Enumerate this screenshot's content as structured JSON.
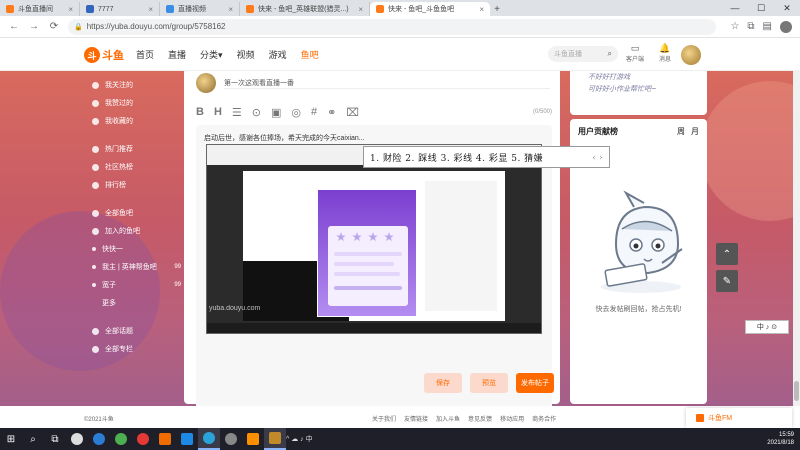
{
  "browser": {
    "tabs": [
      {
        "title": "斗鱼直播间"
      },
      {
        "title": "7777"
      },
      {
        "title": "直播视频"
      },
      {
        "title": "快来 - 鱼吧_英雄联盟(猎灵...)"
      },
      {
        "title": "快来 - 鱼吧_斗鱼鱼吧"
      }
    ],
    "url": "https://yuba.douyu.com/group/5758162",
    "new_tab": "+",
    "min": "—",
    "max": "☐",
    "close": "✕",
    "back": "←",
    "forward": "→",
    "reload": "⟳"
  },
  "header": {
    "logo_mark": "斗",
    "logo_text": "斗鱼",
    "nav": [
      "首页",
      "直播",
      "分类",
      "视频",
      "游戏",
      "鱼吧"
    ],
    "search_placeholder": "斗鱼直播",
    "icons": [
      {
        "name": "客户端",
        "glyph": "▭"
      },
      {
        "name": "消息",
        "glyph": "🔔"
      }
    ]
  },
  "sidebar": {
    "group1": [
      "我关注的",
      "我赞过的",
      "我收藏的"
    ],
    "group2": [
      "热门推荐",
      "社区热榜",
      "排行榜"
    ],
    "group3": [
      "全部鱼吧",
      "加入的鱼吧"
    ],
    "joined": [
      {
        "label": "快快一",
        "num": ""
      },
      {
        "label": "我主 | 英神帮鱼吧",
        "num": "99"
      },
      {
        "label": "宽子",
        "num": "99"
      },
      {
        "label": "更多",
        "num": ""
      }
    ],
    "group4": [
      "全部话题",
      "全部专栏"
    ]
  },
  "post": {
    "title_placeholder": "第一次这观看直播一番",
    "word_count": "(0/500)",
    "body_text": "启动后世，感谢各位捧场，希天完成的今天caixian...",
    "shot_watermark": "yuba.douyu.com",
    "overlay": "1. 财险  2. 踩线  3. 彩线  4. 彩显  5. 猜嫌",
    "overlay_arrow": "‹ ›",
    "buttons": {
      "save": "保存",
      "preview": "预览",
      "publish": "发布帖子"
    }
  },
  "right_panel": {
    "hand_text_1": "不好好打游戏",
    "hand_text_2": "可好好小作业帮忙吧~",
    "ranking_title": "用户贡献榜",
    "tab_week": "周",
    "tab_month": "月",
    "empty_text": "快去发帖刷回帖，抢占先机!"
  },
  "footer": {
    "copyright": "©2021斗鱼",
    "links": [
      "关于我们",
      "友情链接",
      "加入斗鱼",
      "意见反馈",
      "移动应用",
      "商务合作"
    ]
  },
  "toast": {
    "text": "斗鱼FM"
  },
  "ime": {
    "text": "中 ♪ ⊙"
  },
  "taskbar": {
    "time": "15:59",
    "date": "2021/8/18",
    "tray": "^ ☁ ♪ 中"
  },
  "colors": {
    "brand": "#ff6a00",
    "bg_top": "#d86a5e",
    "bg_bottom": "#a35f8a"
  }
}
